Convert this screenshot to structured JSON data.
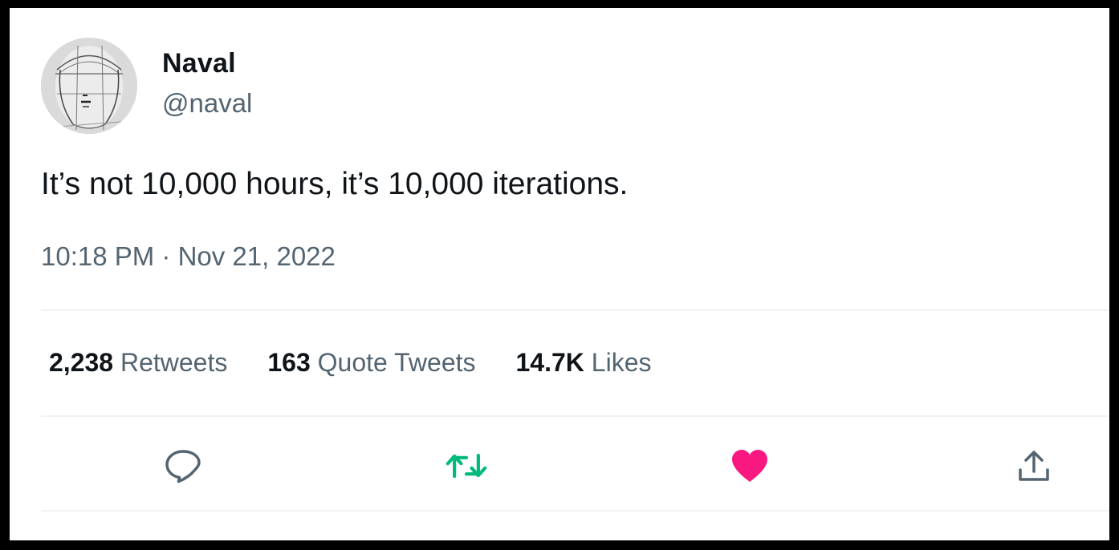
{
  "tweet": {
    "author": {
      "display_name": "Naval",
      "handle": "@naval",
      "avatar_icon": "sketched-face-avatar"
    },
    "text": "It’s not 10,000 hours, it’s 10,000 iterations.",
    "timestamp": "10:18 PM · Nov 21, 2022",
    "stats": [
      {
        "count": "2,238",
        "label": "Retweets"
      },
      {
        "count": "163",
        "label": "Quote Tweets"
      },
      {
        "count": "14.7K",
        "label": "Likes"
      }
    ],
    "actions": [
      {
        "name": "reply",
        "icon": "speech-bubble-icon",
        "color": "#536471"
      },
      {
        "name": "retweet",
        "icon": "retweet-arrows-icon",
        "color": "#00ba7c"
      },
      {
        "name": "like",
        "icon": "heart-icon",
        "color": "#f91880"
      },
      {
        "name": "share",
        "icon": "share-upload-icon",
        "color": "#536471"
      }
    ]
  },
  "colors": {
    "text_primary": "#0f1419",
    "text_secondary": "#536471",
    "divider": "#eff3f4",
    "retweeted": "#00ba7c",
    "liked": "#f91880",
    "frame": "#000000"
  }
}
